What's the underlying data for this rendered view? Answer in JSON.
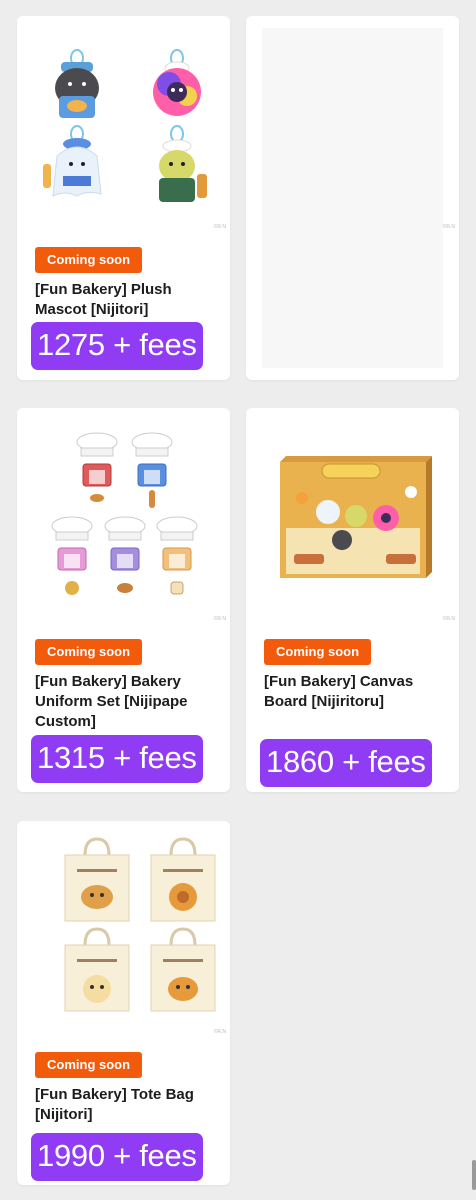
{
  "products": [
    {
      "badge": "Coming soon",
      "title": "[Fun Bakery] Plush Mascot [Nijitori]",
      "price": "1275 + fees",
      "watermark": "©R.N"
    },
    {
      "watermark": "©R.N"
    },
    {
      "badge": "Coming soon",
      "title": "[Fun Bakery] Bakery Uniform Set [Nijipape Custom]",
      "price": "1315 + fees",
      "watermark": "©R.N"
    },
    {
      "badge": "Coming soon",
      "title": "[Fun Bakery] Canvas Board [Nijiritoru]",
      "price": "1860 + fees",
      "watermark": "©R.N"
    },
    {
      "badge": "Coming soon",
      "title": "[Fun Bakery] Tote Bag [Nijitori]",
      "price": "1990 + fees",
      "watermark": "©R.N"
    }
  ],
  "colors": {
    "badge": "#f25a0c",
    "price": "#8f3cf4",
    "background": "#ededed"
  }
}
